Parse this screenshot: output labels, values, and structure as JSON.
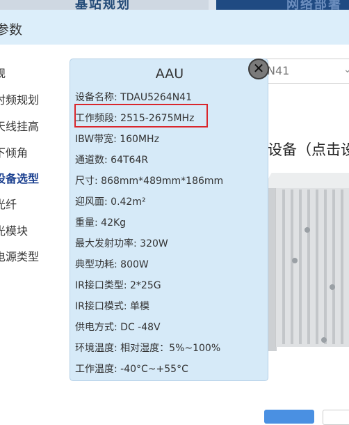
{
  "topbar": {
    "left_tab": "基站规划",
    "right_tab": "网络部署"
  },
  "dialog": {
    "title": "参数"
  },
  "sidebar": {
    "items": [
      {
        "label": "规"
      },
      {
        "label": "时频规划"
      },
      {
        "label": "天线挂高"
      },
      {
        "label": "下倾角"
      },
      {
        "label": "设备选型"
      },
      {
        "label": "光纤"
      },
      {
        "label": "光模块"
      },
      {
        "label": "电源类型"
      }
    ],
    "active_index": 4
  },
  "select": {
    "value": "N41",
    "arrow_icon": "chevron-down-icon"
  },
  "device_section": {
    "title": "设备（点击设"
  },
  "popup": {
    "title": "AAU",
    "close_icon": "close-icon",
    "specs": [
      "设备名称: TDAU5264N41",
      "工作频段: 2515-2675MHz",
      "IBW带宽: 160MHz",
      "通道数: 64T64R",
      "尺寸: 868mm*489mm*186mm",
      "迎风面: 0.42m²",
      "重量: 42Kg",
      "最大发射功率: 320W",
      "典型功耗: 800W",
      "IR接口类型: 2*25G",
      "IR接口模式: 单模",
      "供电方式: DC -48V",
      "环境温度: 相对湿度：5%~100%",
      "工作温度: -40°C~+55°C"
    ],
    "highlighted_index": 1,
    "highlight_color": "#d9262c"
  },
  "colors": {
    "accent": "#1a3f8f",
    "popup_bg": "#d6eaf8",
    "header_bg": "#dceefa"
  }
}
